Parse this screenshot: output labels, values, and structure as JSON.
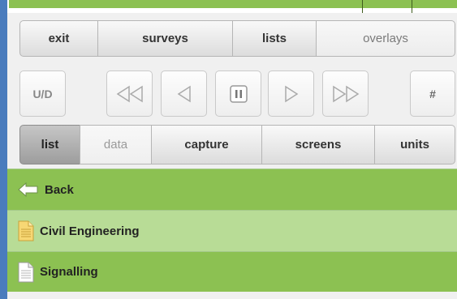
{
  "toolbar_top": {
    "exit": "exit",
    "surveys": "surveys",
    "lists": "lists",
    "overlays": "overlays"
  },
  "playback": {
    "ud": "U/D",
    "hash": "#",
    "icons": [
      "rewind-icon",
      "step-back-icon",
      "pause-icon",
      "play-icon",
      "fast-forward-icon"
    ]
  },
  "tabs": {
    "list": "list",
    "data": "data",
    "capture": "capture",
    "screens": "screens",
    "units": "units"
  },
  "rows": [
    {
      "label": "Back",
      "icon": "back-arrow-icon",
      "bg": "#8cc152"
    },
    {
      "label": "Civil Engineering",
      "icon": "folder-doc-icon",
      "bg": "#b8dc96"
    },
    {
      "label": "Signalling",
      "icon": "document-icon",
      "bg": "#8cc152"
    }
  ],
  "colors": {
    "accent_green": "#8cc152",
    "light_green": "#b8dc96",
    "left_bar": "#4a7cbd",
    "doc_yellow": "#f7d774"
  }
}
